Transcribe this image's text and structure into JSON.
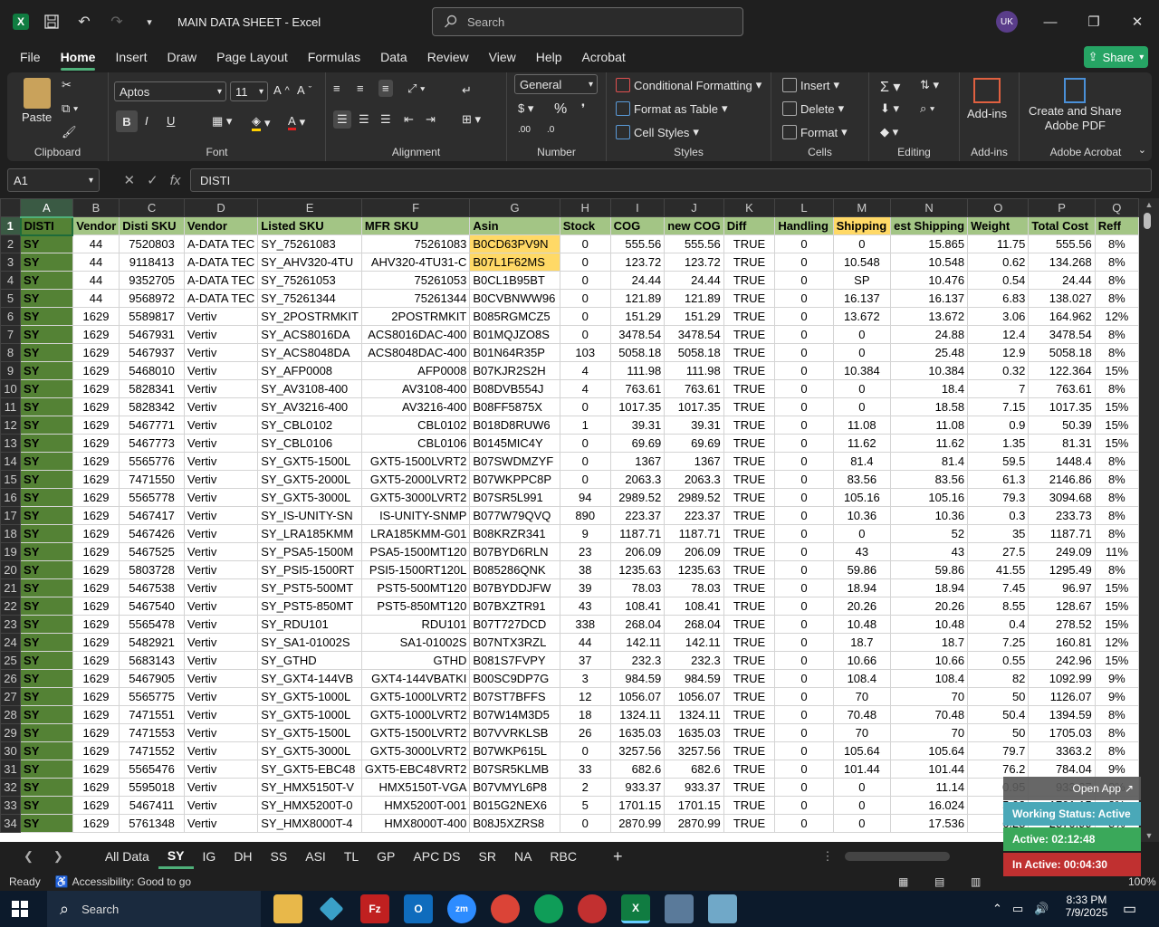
{
  "window": {
    "title": "MAIN DATA SHEET  -  Excel",
    "search_placeholder": "Search",
    "avatar_initials": "UK"
  },
  "menu": [
    "File",
    "Home",
    "Insert",
    "Draw",
    "Page Layout",
    "Formulas",
    "Data",
    "Review",
    "View",
    "Help",
    "Acrobat"
  ],
  "share_label": "Share",
  "ribbon": {
    "clipboard": {
      "paste": "Paste",
      "label": "Clipboard"
    },
    "font": {
      "name": "Aptos",
      "size": "11",
      "label": "Font",
      "bold": "B",
      "italic": "I",
      "underline": "U"
    },
    "alignment": {
      "label": "Alignment"
    },
    "number": {
      "format": "General",
      "label": "Number"
    },
    "styles": {
      "conditional": "Conditional Formatting",
      "format_table": "Format as Table",
      "cell_styles": "Cell Styles",
      "label": "Styles"
    },
    "cells": {
      "insert": "Insert",
      "delete": "Delete",
      "format": "Format",
      "label": "Cells"
    },
    "editing": {
      "label": "Editing"
    },
    "addins": {
      "button": "Add-ins",
      "label": "Add-ins"
    },
    "acrobat": {
      "button_line1": "Create and Share",
      "button_line2": "Adobe PDF",
      "label": "Adobe Acrobat"
    }
  },
  "formula_bar": {
    "name_box": "A1",
    "content": "DISTI"
  },
  "columns": [
    "A",
    "B",
    "C",
    "D",
    "E",
    "F",
    "G",
    "H",
    "I",
    "J",
    "K",
    "L",
    "M",
    "N",
    "O",
    "P",
    "Q"
  ],
  "header_row": [
    "DISTI",
    "Vendor",
    "Disti SKU",
    "Vendor",
    "Listed SKU",
    "MFR SKU",
    "Asin",
    "Stock",
    "COG",
    "new COG",
    "Diff",
    "Handling",
    "Shipping",
    "est Shipping",
    "Weight",
    "Total Cost",
    "Reff"
  ],
  "rows": [
    [
      "SY",
      "44",
      "7520803",
      "A-DATA TEC",
      "SY_75261083",
      "75261083",
      "B0CD63PV9N",
      "0",
      "555.56",
      "555.56",
      "TRUE",
      "0",
      "0",
      "15.865",
      "11.75",
      "555.56",
      "8%"
    ],
    [
      "SY",
      "44",
      "9118413",
      "A-DATA TEC",
      "SY_AHV320-4TU",
      "AHV320-4TU31-C",
      "B07L1F62MS",
      "0",
      "123.72",
      "123.72",
      "TRUE",
      "0",
      "10.548",
      "10.548",
      "0.62",
      "134.268",
      "8%"
    ],
    [
      "SY",
      "44",
      "9352705",
      "A-DATA TEC",
      "SY_75261053",
      "75261053",
      "B0CL1B95BT",
      "0",
      "24.44",
      "24.44",
      "TRUE",
      "0",
      "SP",
      "10.476",
      "0.54",
      "24.44",
      "8%"
    ],
    [
      "SY",
      "44",
      "9568972",
      "A-DATA TEC",
      "SY_75261344",
      "75261344",
      "B0CVBNWW96",
      "0",
      "121.89",
      "121.89",
      "TRUE",
      "0",
      "16.137",
      "16.137",
      "6.83",
      "138.027",
      "8%"
    ],
    [
      "SY",
      "1629",
      "5589817",
      "Vertiv",
      "SY_2POSTRMKIT",
      "2POSTRMKIT",
      "B085RGMCZ5",
      "0",
      "151.29",
      "151.29",
      "TRUE",
      "0",
      "13.672",
      "13.672",
      "3.06",
      "164.962",
      "12%"
    ],
    [
      "SY",
      "1629",
      "5467931",
      "Vertiv",
      "SY_ACS8016DA",
      "ACS8016DAC-400",
      "B01MQJZO8S",
      "0",
      "3478.54",
      "3478.54",
      "TRUE",
      "0",
      "0",
      "24.88",
      "12.4",
      "3478.54",
      "8%"
    ],
    [
      "SY",
      "1629",
      "5467937",
      "Vertiv",
      "SY_ACS8048DA",
      "ACS8048DAC-400",
      "B01N64R35P",
      "103",
      "5058.18",
      "5058.18",
      "TRUE",
      "0",
      "0",
      "25.48",
      "12.9",
      "5058.18",
      "8%"
    ],
    [
      "SY",
      "1629",
      "5468010",
      "Vertiv",
      "SY_AFP0008",
      "AFP0008",
      "B07KJR2S2H",
      "4",
      "111.98",
      "111.98",
      "TRUE",
      "0",
      "10.384",
      "10.384",
      "0.32",
      "122.364",
      "15%"
    ],
    [
      "SY",
      "1629",
      "5828341",
      "Vertiv",
      "SY_AV3108-400",
      "AV3108-400",
      "B08DVB554J",
      "4",
      "763.61",
      "763.61",
      "TRUE",
      "0",
      "0",
      "18.4",
      "7",
      "763.61",
      "8%"
    ],
    [
      "SY",
      "1629",
      "5828342",
      "Vertiv",
      "SY_AV3216-400",
      "AV3216-400",
      "B08FF5875X",
      "0",
      "1017.35",
      "1017.35",
      "TRUE",
      "0",
      "0",
      "18.58",
      "7.15",
      "1017.35",
      "15%"
    ],
    [
      "SY",
      "1629",
      "5467771",
      "Vertiv",
      "SY_CBL0102",
      "CBL0102",
      "B018D8RUW6",
      "1",
      "39.31",
      "39.31",
      "TRUE",
      "0",
      "11.08",
      "11.08",
      "0.9",
      "50.39",
      "15%"
    ],
    [
      "SY",
      "1629",
      "5467773",
      "Vertiv",
      "SY_CBL0106",
      "CBL0106",
      "B0145MIC4Y",
      "0",
      "69.69",
      "69.69",
      "TRUE",
      "0",
      "11.62",
      "11.62",
      "1.35",
      "81.31",
      "15%"
    ],
    [
      "SY",
      "1629",
      "5565776",
      "Vertiv",
      "SY_GXT5-1500L",
      "GXT5-1500LVRT2",
      "B07SWDMZYF",
      "0",
      "1367",
      "1367",
      "TRUE",
      "0",
      "81.4",
      "81.4",
      "59.5",
      "1448.4",
      "8%"
    ],
    [
      "SY",
      "1629",
      "7471550",
      "Vertiv",
      "SY_GXT5-2000L",
      "GXT5-2000LVRT2",
      "B07WKPPC8P",
      "0",
      "2063.3",
      "2063.3",
      "TRUE",
      "0",
      "83.56",
      "83.56",
      "61.3",
      "2146.86",
      "8%"
    ],
    [
      "SY",
      "1629",
      "5565778",
      "Vertiv",
      "SY_GXT5-3000L",
      "GXT5-3000LVRT2",
      "B07SR5L991",
      "94",
      "2989.52",
      "2989.52",
      "TRUE",
      "0",
      "105.16",
      "105.16",
      "79.3",
      "3094.68",
      "8%"
    ],
    [
      "SY",
      "1629",
      "5467417",
      "Vertiv",
      "SY_IS-UNITY-SN",
      "IS-UNITY-SNMP",
      "B077W79QVQ",
      "890",
      "223.37",
      "223.37",
      "TRUE",
      "0",
      "10.36",
      "10.36",
      "0.3",
      "233.73",
      "8%"
    ],
    [
      "SY",
      "1629",
      "5467426",
      "Vertiv",
      "SY_LRA185KMM",
      "LRA185KMM-G01",
      "B08KRZR341",
      "9",
      "1187.71",
      "1187.71",
      "TRUE",
      "0",
      "0",
      "52",
      "35",
      "1187.71",
      "8%"
    ],
    [
      "SY",
      "1629",
      "5467525",
      "Vertiv",
      "SY_PSA5-1500M",
      "PSA5-1500MT120",
      "B07BYD6RLN",
      "23",
      "206.09",
      "206.09",
      "TRUE",
      "0",
      "43",
      "43",
      "27.5",
      "249.09",
      "11%"
    ],
    [
      "SY",
      "1629",
      "5803728",
      "Vertiv",
      "SY_PSI5-1500RT",
      "PSI5-1500RT120L",
      "B085286QNK",
      "38",
      "1235.63",
      "1235.63",
      "TRUE",
      "0",
      "59.86",
      "59.86",
      "41.55",
      "1295.49",
      "8%"
    ],
    [
      "SY",
      "1629",
      "5467538",
      "Vertiv",
      "SY_PST5-500MT",
      "PST5-500MT120",
      "B07BYDDJFW",
      "39",
      "78.03",
      "78.03",
      "TRUE",
      "0",
      "18.94",
      "18.94",
      "7.45",
      "96.97",
      "15%"
    ],
    [
      "SY",
      "1629",
      "5467540",
      "Vertiv",
      "SY_PST5-850MT",
      "PST5-850MT120",
      "B07BXZTR91",
      "43",
      "108.41",
      "108.41",
      "TRUE",
      "0",
      "20.26",
      "20.26",
      "8.55",
      "128.67",
      "15%"
    ],
    [
      "SY",
      "1629",
      "5565478",
      "Vertiv",
      "SY_RDU101",
      "RDU101",
      "B07T727DCD",
      "338",
      "268.04",
      "268.04",
      "TRUE",
      "0",
      "10.48",
      "10.48",
      "0.4",
      "278.52",
      "15%"
    ],
    [
      "SY",
      "1629",
      "5482921",
      "Vertiv",
      "SY_SA1-01002S",
      "SA1-01002S",
      "B07NTX3RZL",
      "44",
      "142.11",
      "142.11",
      "TRUE",
      "0",
      "18.7",
      "18.7",
      "7.25",
      "160.81",
      "12%"
    ],
    [
      "SY",
      "1629",
      "5683143",
      "Vertiv",
      "SY_GTHD",
      "GTHD",
      "B081S7FVPY",
      "37",
      "232.3",
      "232.3",
      "TRUE",
      "0",
      "10.66",
      "10.66",
      "0.55",
      "242.96",
      "15%"
    ],
    [
      "SY",
      "1629",
      "5467905",
      "Vertiv",
      "SY_GXT4-144VB",
      "GXT4-144VBATKI",
      "B00SC9DP7G",
      "3",
      "984.59",
      "984.59",
      "TRUE",
      "0",
      "108.4",
      "108.4",
      "82",
      "1092.99",
      "9%"
    ],
    [
      "SY",
      "1629",
      "5565775",
      "Vertiv",
      "SY_GXT5-1000L",
      "GXT5-1000LVRT2",
      "B07ST7BFFS",
      "12",
      "1056.07",
      "1056.07",
      "TRUE",
      "0",
      "70",
      "70",
      "50",
      "1126.07",
      "9%"
    ],
    [
      "SY",
      "1629",
      "7471551",
      "Vertiv",
      "SY_GXT5-1000L",
      "GXT5-1000LVRT2",
      "B07W14M3D5",
      "18",
      "1324.11",
      "1324.11",
      "TRUE",
      "0",
      "70.48",
      "70.48",
      "50.4",
      "1394.59",
      "8%"
    ],
    [
      "SY",
      "1629",
      "7471553",
      "Vertiv",
      "SY_GXT5-1500L",
      "GXT5-1500LVRT2",
      "B07VVRKLSB",
      "26",
      "1635.03",
      "1635.03",
      "TRUE",
      "0",
      "70",
      "70",
      "50",
      "1705.03",
      "8%"
    ],
    [
      "SY",
      "1629",
      "7471552",
      "Vertiv",
      "SY_GXT5-3000L",
      "GXT5-3000LVRT2",
      "B07WKP615L",
      "0",
      "3257.56",
      "3257.56",
      "TRUE",
      "0",
      "105.64",
      "105.64",
      "79.7",
      "3363.2",
      "8%"
    ],
    [
      "SY",
      "1629",
      "5565476",
      "Vertiv",
      "SY_GXT5-EBC48",
      "GXT5-EBC48VRT2",
      "B07SR5KLMB",
      "33",
      "682.6",
      "682.6",
      "TRUE",
      "0",
      "101.44",
      "101.44",
      "76.2",
      "784.04",
      "9%"
    ],
    [
      "SY",
      "1629",
      "5595018",
      "Vertiv",
      "SY_HMX5150T-V",
      "HMX5150T-VGA",
      "B07VMYL6P8",
      "2",
      "933.37",
      "933.37",
      "TRUE",
      "0",
      "0",
      "11.14",
      "0.95",
      "933.37",
      "8%"
    ],
    [
      "SY",
      "1629",
      "5467411",
      "Vertiv",
      "SY_HMX5200T-0",
      "HMX5200T-001",
      "B015G2NEX6",
      "5",
      "1701.15",
      "1701.15",
      "TRUE",
      "0",
      "0",
      "16.024",
      "5.02",
      "1701.15",
      "8%"
    ],
    [
      "SY",
      "1629",
      "5761348",
      "Vertiv",
      "SY_HMX8000T-4",
      "HMX8000T-400",
      "B08J5XZRS8",
      "0",
      "2870.99",
      "2870.99",
      "TRUE",
      "0",
      "0",
      "17.536",
      "6.28",
      "2870.99",
      "8%"
    ]
  ],
  "sheet_tabs": [
    "All Data",
    "SY",
    "IG",
    "DH",
    "SS",
    "ASI",
    "TL",
    "GP",
    "APC DS",
    "SR",
    "NA",
    "RBC"
  ],
  "active_tab": "SY",
  "status": {
    "ready": "Ready",
    "accessibility": "Accessibility: Good to go",
    "zoom": "100%"
  },
  "overlay": {
    "open_app": "Open App",
    "working_status": "Working Status: Active",
    "active": "Active: 02:12:48",
    "inactive": "In Active: 00:04:30"
  },
  "taskbar": {
    "search": "Search",
    "time": "8:33 PM",
    "date": "7/9/2025"
  }
}
